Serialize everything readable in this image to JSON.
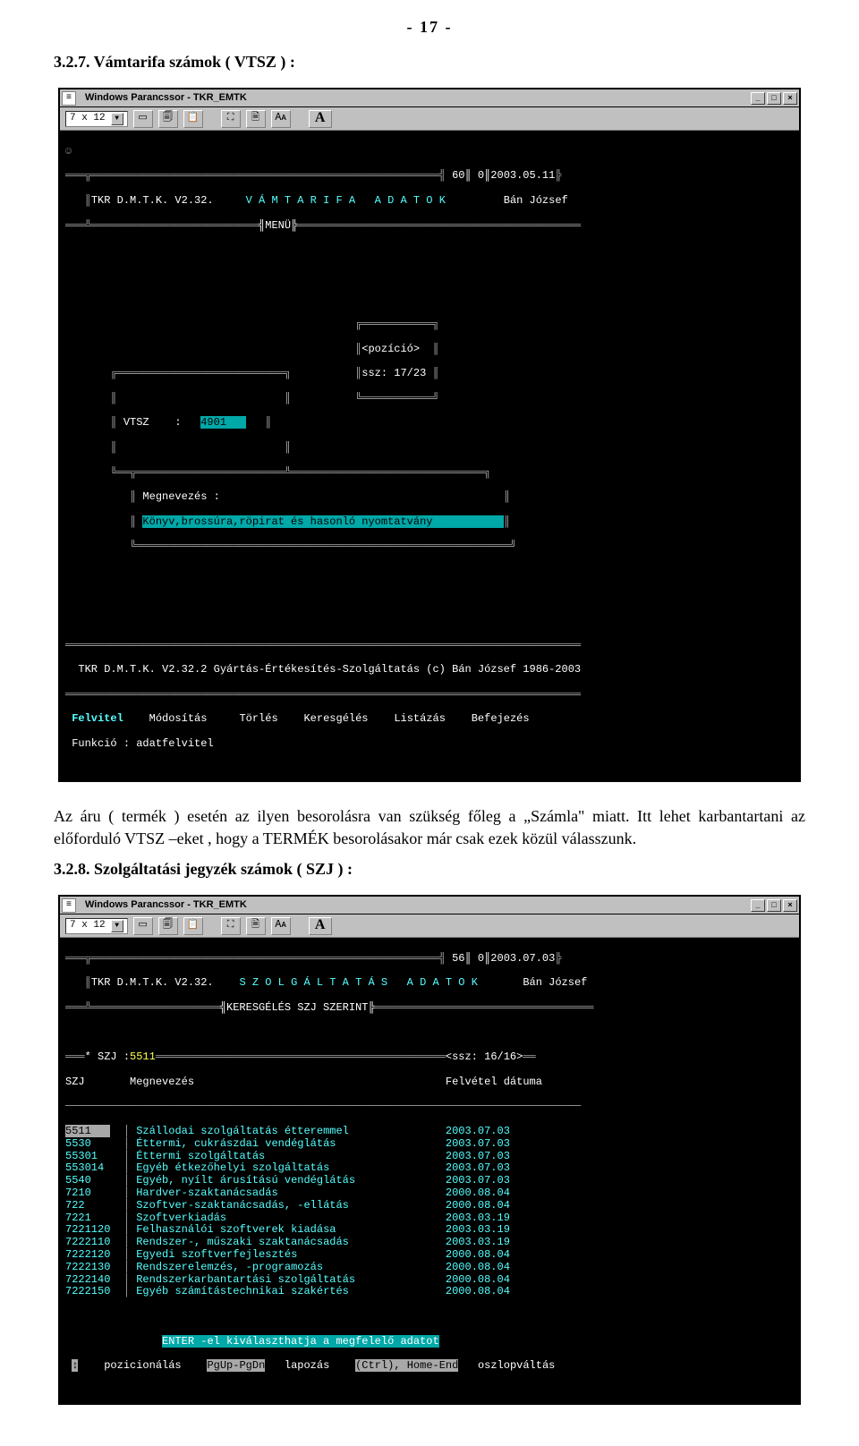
{
  "page_number_label": "-  17  -",
  "section1_heading": "3.2.7. Vámtarifa számok ( VTSZ ) :",
  "paragraph1": "  Az áru ( termék ) esetén az ilyen besorolásra van szükség főleg a „Számla\" miatt. Itt lehet karbantartani az előforduló VTSZ –eket , hogy a TERMÉK besorolásakor már csak ezek közül válasszunk.",
  "section2_heading": "3.2.8. Szolgáltatási jegyzék számok ( SZJ ) :",
  "win1": {
    "titlebar_text": "Windows Parancssor - TKR_EMTK",
    "combo_text": "7 x 12",
    "smiley": "☺",
    "hdr_right": "60║ 0║2003.05.11",
    "hdr_left": "TKR D.M.T.K. V2.32.",
    "hdr_center": "V Á M T A R I F A   A D A T O K",
    "hdr_name": "Bán József",
    "menu_label": "╣MENÜ╠",
    "pos_label": "<pozíció>",
    "pos_value": "ssz: 17/23",
    "vtsz_label": "VTSZ    :",
    "vtsz_value": "4901",
    "megn_label": "Megnevezés :",
    "megn_value": "Könyv,brossúra,röpirat és hasonló nyomtatvány",
    "footer_line": "TKR D.M.T.K. V2.32.2 Gyártás-Értékesítés-Szolgáltatás (c) Bán József 1986-2003",
    "menu_items": [
      "Felvitel",
      "Módosítás",
      "Törlés",
      "Keresgélés",
      "Listázás",
      "Befejezés"
    ],
    "func_label": "Funkció : adatfelvitel"
  },
  "win2": {
    "titlebar_text": "Windows Parancssor - TKR_EMTK",
    "combo_text": "7 x 12",
    "hdr_right": "56║ 0║2003.07.03",
    "hdr_left": "TKR D.M.T.K. V2.32.",
    "hdr_center": "S Z O L G Á L T A T Á S   A D A T O K",
    "hdr_name": "Bán József",
    "menu_label": "╣KERESGÉLÉS SZJ SZERINT╠",
    "search_label": "* SZJ :",
    "search_value": "5511",
    "ssz_label": "<ssz: 16/16>",
    "col1": "SZJ",
    "col2": "Megnevezés",
    "col3": "Felvétel dátuma",
    "rows": [
      {
        "szj": "5511",
        "nev": "Szállodai szolgáltatás étteremmel",
        "dat": "2003.07.03",
        "sel": true
      },
      {
        "szj": "5530",
        "nev": "Éttermi, cukrászdai vendéglátás",
        "dat": "2003.07.03"
      },
      {
        "szj": "55301",
        "nev": "Éttermi szolgáltatás",
        "dat": "2003.07.03"
      },
      {
        "szj": "553014",
        "nev": "Egyéb étkezőhelyi szolgáltatás",
        "dat": "2003.07.03"
      },
      {
        "szj": "5540",
        "nev": "Egyéb, nyílt árusítású vendéglátás",
        "dat": "2003.07.03"
      },
      {
        "szj": "7210",
        "nev": "Hardver-szaktanácsadás",
        "dat": "2000.08.04"
      },
      {
        "szj": "722",
        "nev": "Szoftver-szaktanácsadás, -ellátás",
        "dat": "2000.08.04"
      },
      {
        "szj": "7221",
        "nev": "Szoftverkiadás",
        "dat": "2003.03.19"
      },
      {
        "szj": "7221120",
        "nev": "Felhasználói szoftverek kiadása",
        "dat": "2003.03.19"
      },
      {
        "szj": "7222110",
        "nev": "Rendszer-, műszaki szaktanácsadás",
        "dat": "2003.03.19"
      },
      {
        "szj": "7222120",
        "nev": "Egyedi szoftverfejlesztés",
        "dat": "2000.08.04"
      },
      {
        "szj": "7222130",
        "nev": "Rendszerelemzés, -programozás",
        "dat": "2000.08.04"
      },
      {
        "szj": "7222140",
        "nev": "Rendszerkarbantartási szolgáltatás",
        "dat": "2000.08.04"
      },
      {
        "szj": "7222150",
        "nev": "Egyéb számítástechnikai szakértés",
        "dat": "2000.08.04"
      }
    ],
    "help1a": "ENTER -el kiválaszthatja a megfelelő adatot",
    "help_arrows": "↕",
    "help2a": "pozicionálás",
    "help2b": "PgUp-PgDn",
    "help2c": "lapozás",
    "help2d": "(Ctrl), Home-End",
    "help2e": "oszlopváltás"
  },
  "icons": {
    "mark": "✓",
    "copy": "⧉",
    "paste": "📋",
    "full": "⛶",
    "props": "🗎",
    "font": "🗛",
    "a": "A",
    "min": "_",
    "max": "□",
    "close": "×",
    "down": "▼",
    "sys": "≡"
  }
}
